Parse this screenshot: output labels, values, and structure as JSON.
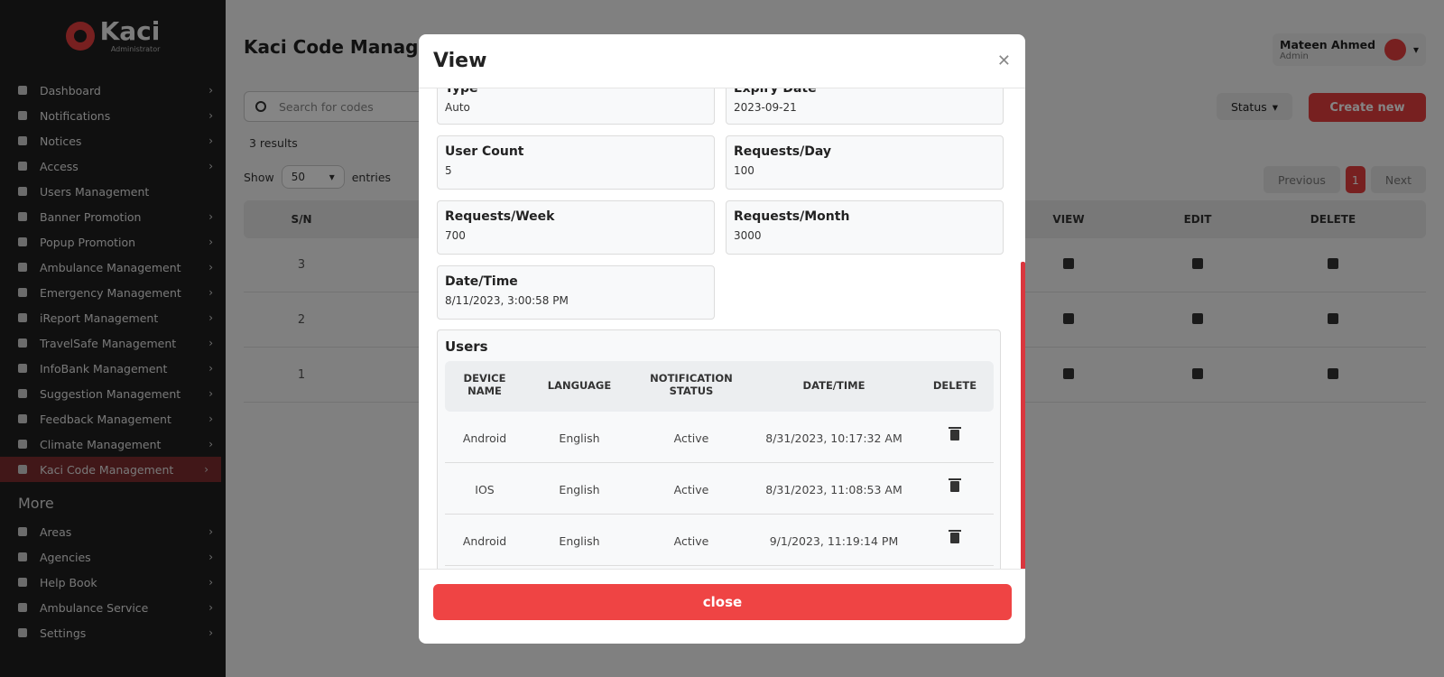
{
  "app": {
    "logo_name": "Kaci",
    "logo_sub": "Administrator"
  },
  "sidebar": {
    "items": [
      {
        "label": "Dashboard",
        "icon": "dashboard-icon"
      },
      {
        "label": "Notifications",
        "icon": "bell-icon"
      },
      {
        "label": "Notices",
        "icon": "notice-icon"
      },
      {
        "label": "Access",
        "icon": "lock-icon"
      },
      {
        "label": "Users Management",
        "icon": "user-icon"
      },
      {
        "label": "Banner Promotion",
        "icon": "banner-icon"
      },
      {
        "label": "Popup Promotion",
        "icon": "popup-icon"
      },
      {
        "label": "Ambulance Management",
        "icon": "ambulance-icon"
      },
      {
        "label": "Emergency Management",
        "icon": "emergency-icon"
      },
      {
        "label": "iReport Management",
        "icon": "report-icon"
      },
      {
        "label": "TravelSafe Management",
        "icon": "travel-icon"
      },
      {
        "label": "InfoBank Management",
        "icon": "info-icon"
      },
      {
        "label": "Suggestion Management",
        "icon": "suggestion-icon"
      },
      {
        "label": "Feedback Management",
        "icon": "feedback-icon"
      },
      {
        "label": "Climate Management",
        "icon": "globe-icon"
      },
      {
        "label": "Kaci Code Management",
        "icon": "code-icon",
        "active": true
      }
    ],
    "more_title": "More",
    "more_items": [
      {
        "label": "Areas",
        "icon": "map-icon"
      },
      {
        "label": "Agencies",
        "icon": "building-icon"
      },
      {
        "label": "Help Book",
        "icon": "people-icon"
      },
      {
        "label": "Ambulance Service",
        "icon": "ambulance-icon"
      },
      {
        "label": "Settings",
        "icon": "gear-icon"
      }
    ]
  },
  "page": {
    "title": "Kaci Code Manage",
    "search_placeholder": "Search for codes",
    "results": "3 results",
    "show_label": "Show",
    "entries_value": "50",
    "entries_label": "entries",
    "status_label": "Status",
    "create_label": "Create new",
    "prev_label": "Previous",
    "current_page": "1",
    "next_label": "Next",
    "user_name": "Mateen Ahmed",
    "user_role": "Admin",
    "columns": {
      "sn": "S/N",
      "view": "VIEW",
      "edit": "EDIT",
      "delete": "DELETE"
    },
    "rows": [
      {
        "sn": "3"
      },
      {
        "sn": "2"
      },
      {
        "sn": "1"
      }
    ]
  },
  "modal": {
    "title": "View",
    "fields": {
      "type": {
        "label": "Type",
        "value": "Auto"
      },
      "expiry": {
        "label": "Expiry Date",
        "value": "2023-09-21"
      },
      "user_count": {
        "label": "User Count",
        "value": "5"
      },
      "req_day": {
        "label": "Requests/Day",
        "value": "100"
      },
      "req_week": {
        "label": "Requests/Week",
        "value": "700"
      },
      "req_month": {
        "label": "Requests/Month",
        "value": "3000"
      },
      "datetime": {
        "label": "Date/Time",
        "value": "8/11/2023, 3:00:58 PM"
      }
    },
    "users_title": "Users",
    "users_columns": {
      "device_1": "DEVICE",
      "device_2": "NAME",
      "language": "LANGUAGE",
      "notif_1": "NOTIFICATION",
      "notif_2": "STATUS",
      "datetime": "DATE/TIME",
      "delete": "DELETE"
    },
    "users": [
      {
        "device": "Android",
        "language": "English",
        "status": "Active",
        "datetime": "8/31/2023, 10:17:32 AM"
      },
      {
        "device": "IOS",
        "language": "English",
        "status": "Active",
        "datetime": "8/31/2023, 11:08:53 AM"
      },
      {
        "device": "Android",
        "language": "English",
        "status": "Active",
        "datetime": "9/1/2023, 11:19:14 PM"
      }
    ],
    "close_label": "close"
  },
  "colors": {
    "accent": "#e53e3e",
    "sidebar_bg": "#1f1f1f",
    "active_item": "#7e2c2f"
  }
}
